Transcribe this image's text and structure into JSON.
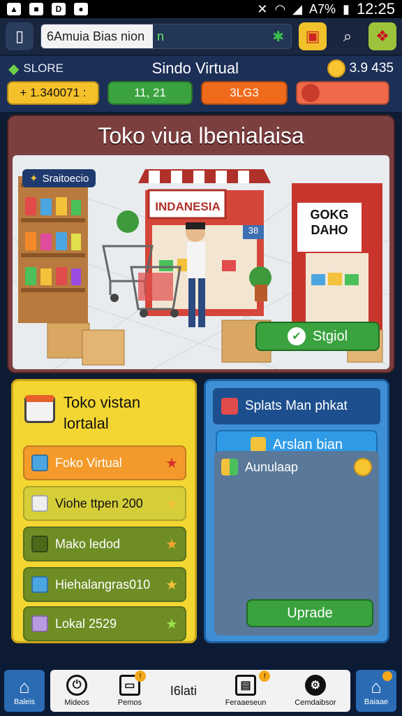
{
  "statusbar": {
    "battery": "A7%",
    "time": "12:25"
  },
  "topbar": {
    "address_text": "6Amuia Bias nion",
    "address_suffix": "n"
  },
  "hud": {
    "store_label": "SLORE",
    "title": "Sindo Virtual",
    "coins": "3.9 435",
    "pill1": "+ 1.340071 :",
    "pill2": "11, 21",
    "pill3": "3LG3",
    "pill4": ""
  },
  "main": {
    "title": "Toko viua lbenialaisa",
    "scene_tag": "Sraitoecio",
    "shop_sign": "INDANESIA",
    "shop2_sign": "GOKG DAHO",
    "shop_number": "38",
    "start_label": "Stgiol"
  },
  "left": {
    "title": "Toko vistan lortalal",
    "items": [
      {
        "label": "Foko Virtual",
        "color": "#f39a2a"
      },
      {
        "label": "Viohe ttpen 200",
        "color": "#d6ce38"
      },
      {
        "label": "Mako ledod",
        "color": "#6e8d25"
      },
      {
        "label": "Hiehalangras010",
        "color": "#6e8d25"
      },
      {
        "label": "Lokal 2529",
        "color": "#6e8d25"
      }
    ]
  },
  "right": {
    "title": "Splats Man phkat",
    "button": "Arslan bian",
    "list_item": "Aunulaap",
    "upgrade": "Uprade"
  },
  "nav": {
    "home_left": "Baleis",
    "items": [
      "Mideos",
      "Pemos",
      "I6lati",
      "Feraaeseun",
      "Cemdaibsor"
    ],
    "home_right": "Baiaae"
  }
}
